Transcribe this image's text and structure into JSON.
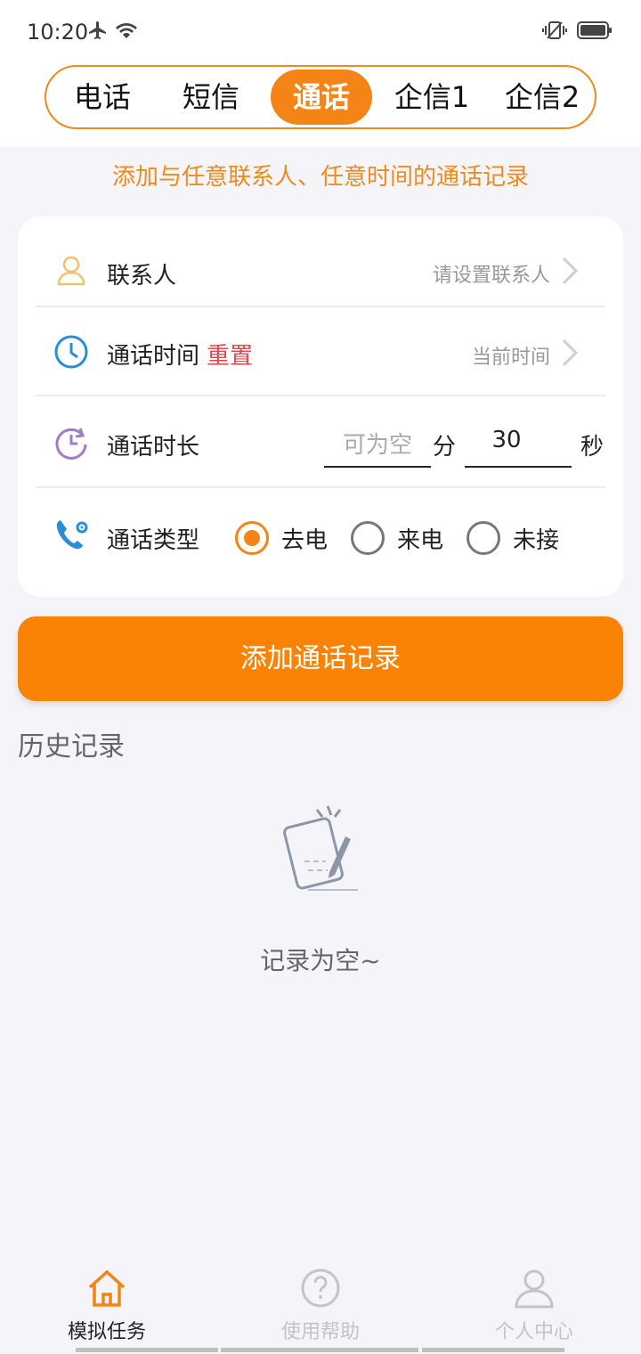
{
  "status_bar": {
    "time": "10:20",
    "left_icons": [
      "airplane-icon",
      "wifi-icon"
    ],
    "right_icons": [
      "vibrate-icon",
      "battery-icon"
    ]
  },
  "tabs": [
    {
      "label": "电话",
      "active": false
    },
    {
      "label": "短信",
      "active": false
    },
    {
      "label": "通话",
      "active": true
    },
    {
      "label": "企信1",
      "active": false
    },
    {
      "label": "企信2",
      "active": false
    }
  ],
  "subtitle": "添加与任意联系人、任意时间的通话记录",
  "form": {
    "contact": {
      "label": "联系人",
      "value": "请设置联系人",
      "icon": "person-icon"
    },
    "call_time": {
      "label": "通话时间",
      "reset": "重置",
      "value": "当前时间",
      "icon": "clock-icon"
    },
    "duration": {
      "label": "通话时长",
      "minutes_placeholder": "可为空",
      "minutes_unit": "分",
      "seconds_value": "30",
      "seconds_unit": "秒",
      "icon": "history-clock-icon"
    },
    "call_type": {
      "label": "通话类型",
      "icon": "phone-settings-icon",
      "options": [
        {
          "label": "去电",
          "checked": true
        },
        {
          "label": "来电",
          "checked": false
        },
        {
          "label": "未接",
          "checked": false
        }
      ]
    }
  },
  "submit_label": "添加通话记录",
  "history": {
    "title": "历史记录",
    "empty_text": "记录为空~",
    "empty_icon": "empty-notebook-icon"
  },
  "bottom_nav": [
    {
      "label": "模拟任务",
      "icon": "home-icon",
      "active": true
    },
    {
      "label": "使用帮助",
      "icon": "help-icon",
      "active": false
    },
    {
      "label": "个人中心",
      "icon": "user-icon",
      "active": false
    }
  ],
  "colors": {
    "accent": "#f38415",
    "danger": "#e8464a",
    "background": "#f5f5f9"
  }
}
